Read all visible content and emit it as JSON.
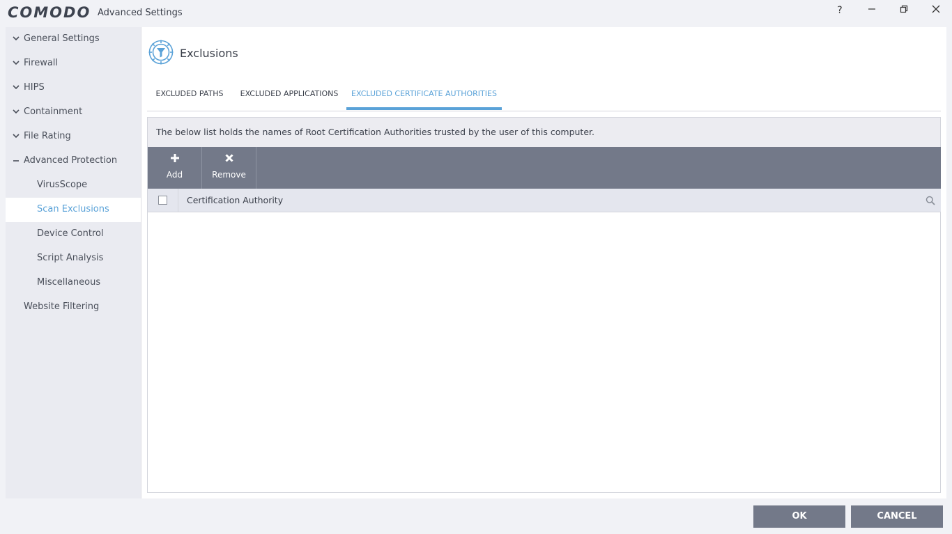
{
  "window": {
    "brand": "COMODO",
    "title": "Advanced Settings",
    "help_label": "?",
    "minimize_label": "—",
    "restore_label": "❐",
    "close_label": "✕"
  },
  "sidebar": {
    "items": [
      {
        "label": "General Settings",
        "indicator": "chevron-down-icon"
      },
      {
        "label": "Firewall",
        "indicator": "chevron-down-icon"
      },
      {
        "label": "HIPS",
        "indicator": "chevron-down-icon"
      },
      {
        "label": "Containment",
        "indicator": "chevron-down-icon"
      },
      {
        "label": "File Rating",
        "indicator": "chevron-down-icon"
      },
      {
        "label": "Advanced Protection",
        "indicator": "minus-icon"
      },
      {
        "label": "VirusScope"
      },
      {
        "label": "Scan Exclusions",
        "selected": true
      },
      {
        "label": "Device Control"
      },
      {
        "label": "Script Analysis"
      },
      {
        "label": "Miscellaneous"
      },
      {
        "label": "Website Filtering"
      }
    ]
  },
  "main": {
    "title": "Exclusions",
    "icon": "funnel-filter-icon",
    "tabs": [
      {
        "label": "EXCLUDED PATHS"
      },
      {
        "label": "EXCLUDED APPLICATIONS"
      },
      {
        "label": "EXCLUDED CERTIFICATE AUTHORITIES",
        "active": true
      }
    ],
    "description": "The below list holds the names of Root Certification Authorities trusted by the user of this computer.",
    "toolbar": {
      "add_label": "Add",
      "remove_label": "Remove"
    },
    "table": {
      "columns": [
        "Certification Authority"
      ],
      "rows": []
    }
  },
  "footer": {
    "ok_label": "OK",
    "cancel_label": "CANCEL"
  },
  "colors": {
    "accent": "#5aa2d8",
    "toolbar": "#737989",
    "background": "#f1f2f6"
  }
}
